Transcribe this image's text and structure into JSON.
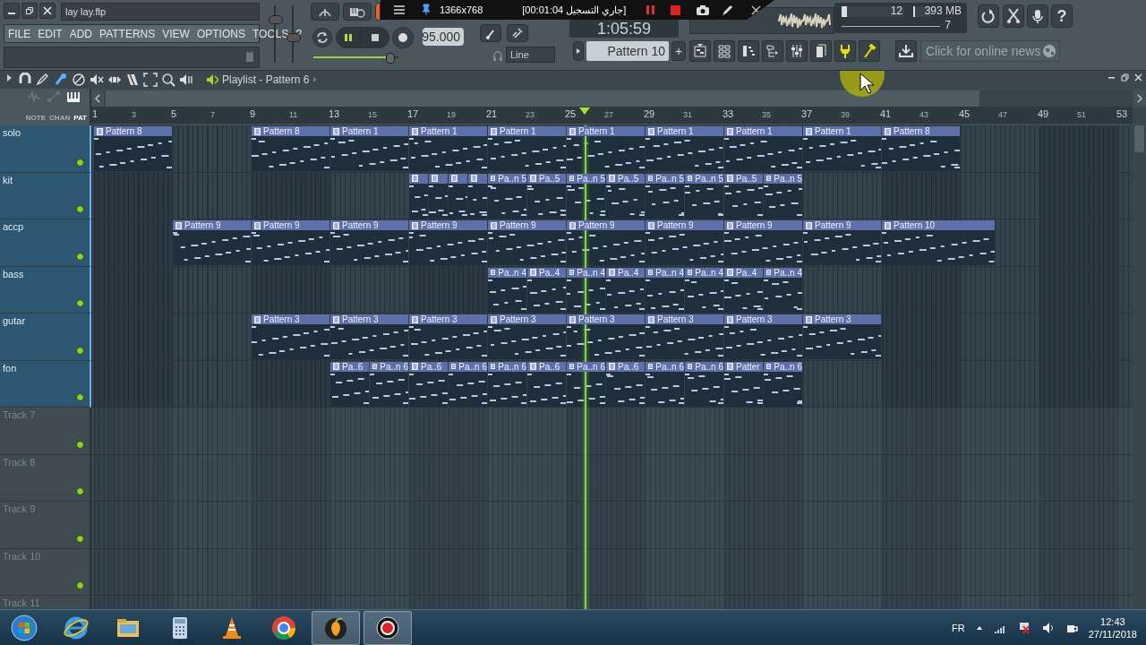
{
  "title_field": {
    "value": "lay lay.flp"
  },
  "menu": [
    "FILE",
    "EDIT",
    "ADD",
    "PATTERNS",
    "VIEW",
    "OPTIONS",
    "TOOLS",
    "?"
  ],
  "master": {
    "volume": {
      "level": 0.8
    },
    "pitch": {
      "level": 0.45
    }
  },
  "transport": {
    "playing": true,
    "tempo": "95.000",
    "snap": "Line",
    "time": "1:05:59",
    "song_position": {
      "level": 0.9
    }
  },
  "recorder": {
    "resolution": "1366x768",
    "status": "[جاري التسجيل 00:01:04]"
  },
  "monitor": {
    "cpu_meter": {
      "level": 0.08
    },
    "cpu": "12",
    "memory_meter": {
      "level": 0.1
    },
    "memory": "393 MB",
    "polyphony": "7"
  },
  "help_button": "?",
  "pattern_selector": {
    "value": "Pattern 10",
    "add": "+"
  },
  "news": "Click for online news",
  "playlist": {
    "title": "Playlist - Pattern 6",
    "modes": [
      {
        "label": "NOTE",
        "selected": false
      },
      {
        "label": "CHAN",
        "selected": false
      },
      {
        "label": "PAT",
        "selected": true
      }
    ],
    "ruler": [
      "1",
      "3",
      "5",
      "7",
      "9",
      "11",
      "13",
      "15",
      "17",
      "19",
      "21",
      "23",
      "25",
      "27",
      "29",
      "31",
      "33",
      "35",
      "37",
      "39",
      "41",
      "43",
      "45",
      "47",
      "49",
      "51",
      "53"
    ],
    "playhead": {
      "level": 0.474
    },
    "tracks": [
      {
        "name": "solo",
        "clips": [
          {
            "kind": "long",
            "label": "Pattern 8"
          },
          {
            "kind": "gap"
          },
          {
            "kind": "long",
            "label": "Pattern 8"
          },
          {
            "kind": "long",
            "label": "Pattern 1"
          },
          {
            "kind": "long",
            "label": "Pattern 1"
          },
          {
            "kind": "long",
            "label": "Pattern 1"
          },
          {
            "kind": "long",
            "label": "Pattern 1"
          },
          {
            "kind": "long",
            "label": "Pattern 1"
          },
          {
            "kind": "long",
            "label": "Pattern 1"
          },
          {
            "kind": "long",
            "label": "Pattern 1"
          },
          {
            "kind": "long",
            "label": "Pattern 8"
          }
        ]
      },
      {
        "name": "kit",
        "clips": [
          {
            "kind": "gap"
          },
          {
            "kind": "gap"
          },
          {
            "kind": "gap"
          },
          {
            "kind": "gap"
          },
          {
            "kind": "single"
          },
          {
            "kind": "single"
          },
          {
            "kind": "single"
          },
          {
            "kind": "single"
          },
          {
            "kind": "short",
            "label": "Pa..n 5"
          },
          {
            "kind": "short",
            "label": "Pa..5"
          },
          {
            "kind": "short",
            "label": "Pa..n 5"
          },
          {
            "kind": "short",
            "label": "Pa..5"
          },
          {
            "kind": "short",
            "label": "Pa..n 5"
          },
          {
            "kind": "short",
            "label": "Pa..n 5"
          },
          {
            "kind": "short",
            "label": "Pa..5"
          },
          {
            "kind": "short",
            "label": "Pa..n 5"
          }
        ]
      },
      {
        "name": "accp",
        "clips": [
          {
            "kind": "gap"
          },
          {
            "kind": "long",
            "label": "Pattern 9"
          },
          {
            "kind": "long",
            "label": "Pattern 9"
          },
          {
            "kind": "long",
            "label": "Pattern 9"
          },
          {
            "kind": "long",
            "label": "Pattern 9"
          },
          {
            "kind": "long",
            "label": "Pattern 9"
          },
          {
            "kind": "long",
            "label": "Pattern 9"
          },
          {
            "kind": "long",
            "label": "Pattern 9"
          },
          {
            "kind": "long",
            "label": "Pattern 9"
          },
          {
            "kind": "long",
            "label": "Pattern 9"
          },
          {
            "kind": "wide",
            "label": "Pattern 10"
          }
        ]
      },
      {
        "name": "bass",
        "clips": [
          {
            "kind": "gap"
          },
          {
            "kind": "gap"
          },
          {
            "kind": "gap"
          },
          {
            "kind": "gap"
          },
          {
            "kind": "gap"
          },
          {
            "kind": "short",
            "label": "Pa..n 4"
          },
          {
            "kind": "short",
            "label": "Pa..4"
          },
          {
            "kind": "short",
            "label": "Pa..n 4"
          },
          {
            "kind": "short",
            "label": "Pa..4"
          },
          {
            "kind": "short",
            "label": "Pa..n 4"
          },
          {
            "kind": "short",
            "label": "Pa..n 4"
          },
          {
            "kind": "short",
            "label": "Pa..4"
          },
          {
            "kind": "short",
            "label": "Pa..n 4"
          }
        ]
      },
      {
        "name": "gutar",
        "clips": [
          {
            "kind": "gap"
          },
          {
            "kind": "gap"
          },
          {
            "kind": "long",
            "label": "Pattern 3"
          },
          {
            "kind": "long",
            "label": "Pattern 3"
          },
          {
            "kind": "long",
            "label": "Pattern 3"
          },
          {
            "kind": "long",
            "label": "Pattern 3"
          },
          {
            "kind": "long",
            "label": "Pattern 3"
          },
          {
            "kind": "long",
            "label": "Pattern 3"
          },
          {
            "kind": "long",
            "label": "Pattern 3"
          },
          {
            "kind": "long",
            "label": "Pattern 3"
          }
        ]
      },
      {
        "name": "fon",
        "clips": [
          {
            "kind": "gap"
          },
          {
            "kind": "gap"
          },
          {
            "kind": "gap"
          },
          {
            "kind": "short",
            "label": "Pa..6"
          },
          {
            "kind": "short",
            "label": "Pa..n 6"
          },
          {
            "kind": "short",
            "label": "Pa..6"
          },
          {
            "kind": "short",
            "label": "Pa..n 6"
          },
          {
            "kind": "short",
            "label": "Pa..n 6"
          },
          {
            "kind": "short",
            "label": "Pa..6"
          },
          {
            "kind": "short",
            "label": "Pa..n 6"
          },
          {
            "kind": "short",
            "label": "Pa..6"
          },
          {
            "kind": "short",
            "label": "Pa..n 6"
          },
          {
            "kind": "short",
            "label": "Pa..n 6"
          },
          {
            "kind": "short",
            "label": "Patter"
          },
          {
            "kind": "short",
            "label": "Pa..n 6"
          }
        ]
      },
      {
        "name": "Track 7"
      },
      {
        "name": "Track 8"
      },
      {
        "name": "Track 9"
      },
      {
        "name": "Track 10"
      },
      {
        "name": "Track 11"
      }
    ]
  },
  "taskbar": {
    "language": "FR",
    "time": "12:43",
    "date": "27/11/2018"
  }
}
